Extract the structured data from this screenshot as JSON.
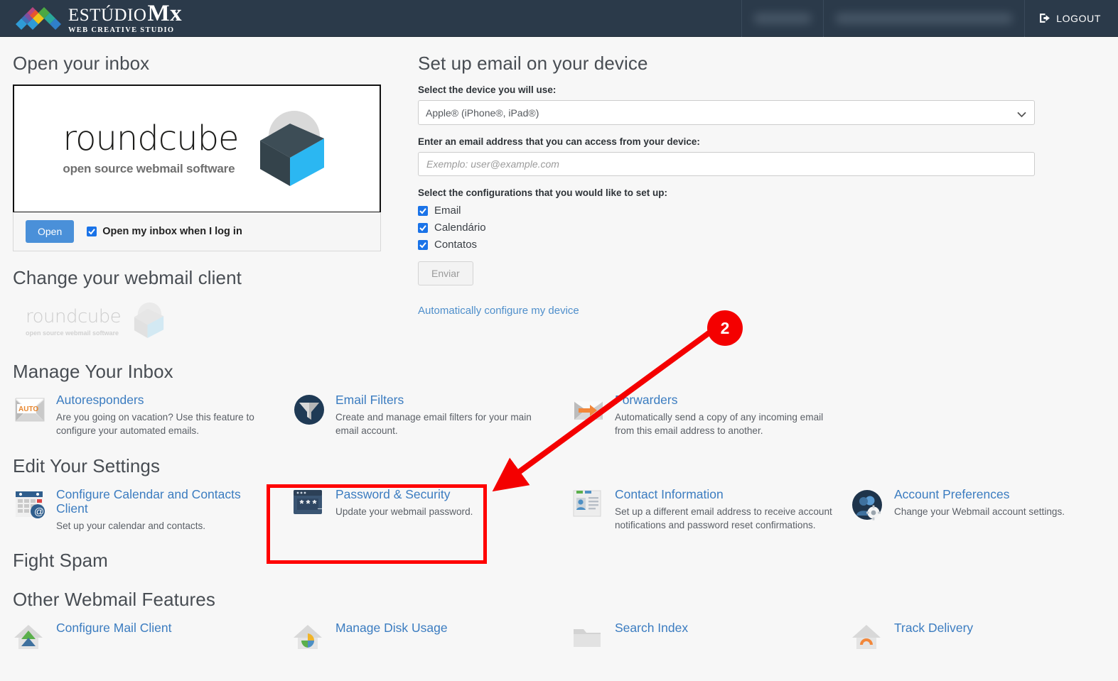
{
  "header": {
    "brand_line1": "ESTÚDIO",
    "brand_mx": "Mx",
    "brand_line2": "WEB CREATIVE STUDIO",
    "user_cell_redacted": "",
    "account_cell_redacted": "",
    "logout_label": "LOGOUT",
    "bar_color": "#2b3a4a"
  },
  "left": {
    "open_inbox_heading": "Open your inbox",
    "roundcube": {
      "wordmark": "roundcube",
      "tagline": "open source webmail software"
    },
    "open_button": "Open",
    "open_checkbox_label": "Open my inbox when I log in",
    "change_client_heading": "Change your webmail client",
    "change_client_logo": {
      "wordmark": "roundcube",
      "tagline": "open source webmail software"
    }
  },
  "setup": {
    "heading": "Set up email on your device",
    "device_label": "Select the device you will use:",
    "device_selected": "Apple® (iPhone®, iPad®)",
    "device_options": [
      "Apple® (iPhone®, iPad®)"
    ],
    "email_label": "Enter an email address that you can access from your device:",
    "email_value": "",
    "email_placeholder": "Exemplo: user@example.com",
    "configs_label": "Select the configurations that you would like to set up:",
    "configs": [
      {
        "label": "Email",
        "checked": true
      },
      {
        "label": "Calendário",
        "checked": true
      },
      {
        "label": "Contatos",
        "checked": true
      }
    ],
    "submit_label": "Enviar",
    "auto_link": "Automatically configure my device"
  },
  "manage_inbox": {
    "heading": "Manage Your Inbox",
    "items": [
      {
        "title": "Autoresponders",
        "desc": "Are you going on vacation? Use this feature to configure your automated emails.",
        "icon": "autoresponder-envelope-icon"
      },
      {
        "title": "Email Filters",
        "desc": "Create and manage email filters for your main email account.",
        "icon": "funnel-icon"
      },
      {
        "title": "Forwarders",
        "desc": "Automatically send a copy of any incoming email from this email address to another.",
        "icon": "forward-envelope-icon"
      }
    ]
  },
  "edit_settings": {
    "heading": "Edit Your Settings",
    "items": [
      {
        "title": "Configure Calendar and Contacts Client",
        "desc": "Set up your calendar and contacts.",
        "icon": "calendar-contacts-icon"
      },
      {
        "title": "Password & Security",
        "desc": "Update your webmail password.",
        "icon": "password-terminal-icon"
      },
      {
        "title": "Contact Information",
        "desc": "Set up a different email address to receive account notifications and password reset confirmations.",
        "icon": "contact-card-icon"
      },
      {
        "title": "Account Preferences",
        "desc": "Change your Webmail account settings.",
        "icon": "account-gear-icon"
      }
    ]
  },
  "fight_spam": {
    "heading": "Fight Spam"
  },
  "other_features": {
    "heading": "Other Webmail Features",
    "items": [
      {
        "title": "Configure Mail Client",
        "icon": "home-blue-icon"
      },
      {
        "title": "Manage Disk Usage",
        "icon": "home-pie-icon"
      },
      {
        "title": "Search Index",
        "icon": "folder-icon"
      },
      {
        "title": "Track Delivery",
        "icon": "home-orange-icon"
      }
    ]
  },
  "annotations": {
    "step_badge": "2",
    "badge_color": "#f40000",
    "highlight_color": "#ff0000",
    "highlight_target": "Password & Security"
  }
}
